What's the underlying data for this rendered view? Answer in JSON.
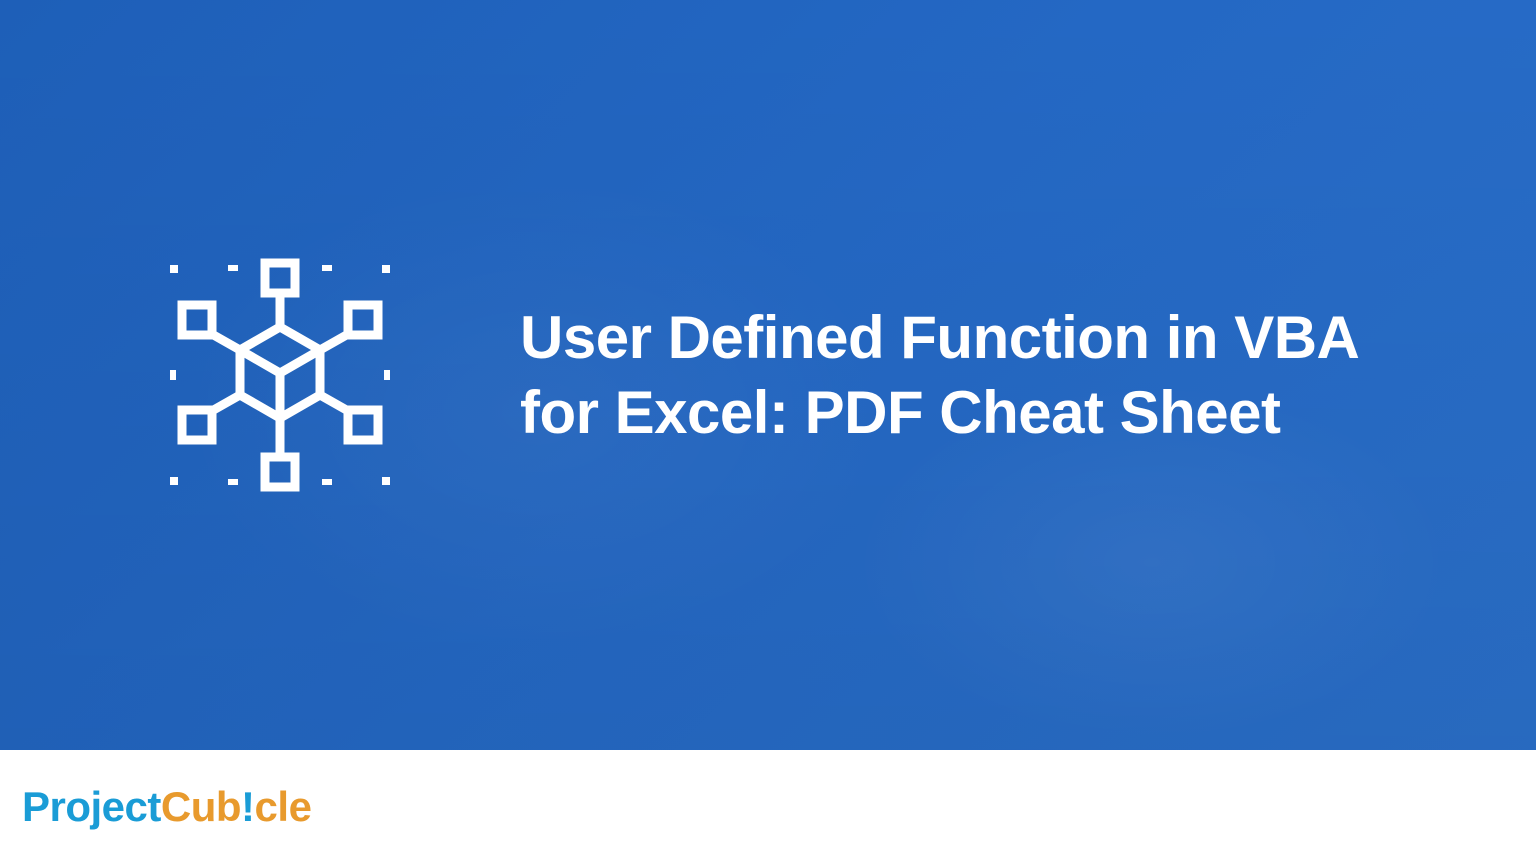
{
  "hero": {
    "title": "User Defined Function in VBA for Excel: PDF Cheat Sheet",
    "icon_name": "cube-network-icon"
  },
  "logo": {
    "part1": "Project",
    "part2": "Cub",
    "part3": "!",
    "part4": "cle"
  },
  "colors": {
    "hero_bg": "#2468c4",
    "logo_blue": "#1a9cd6",
    "logo_orange": "#e89a2d",
    "text_white": "#ffffff"
  }
}
